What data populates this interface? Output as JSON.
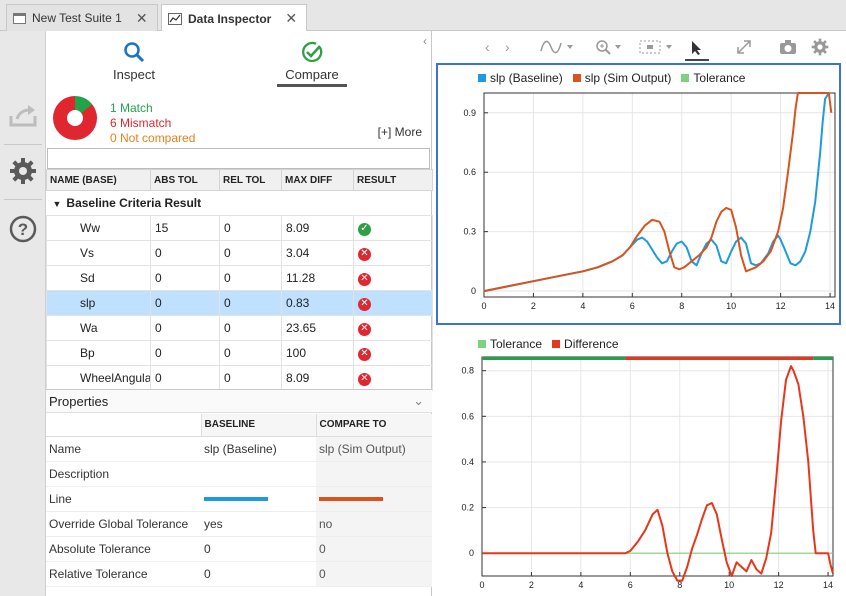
{
  "tabs": [
    {
      "label": "New Test Suite 1",
      "active": false
    },
    {
      "label": "Data Inspector",
      "active": true
    }
  ],
  "modes": {
    "inspect": "Inspect",
    "compare": "Compare"
  },
  "summary": {
    "match": "1 Match",
    "mismatch": "6 Mismatch",
    "not_compared": "0 Not compared",
    "more": "[+] More",
    "counts": {
      "match": 1,
      "mismatch": 6,
      "not_compared": 0
    }
  },
  "filter": {
    "placeholder": ""
  },
  "table": {
    "columns": [
      "NAME (BASE)",
      "ABS TOL",
      "REL TOL",
      "MAX DIFF",
      "RESULT"
    ],
    "group": "Baseline Criteria Result",
    "rows": [
      {
        "name": "Ww",
        "abs_tol": "15",
        "rel_tol": "0",
        "max_diff": "8.09",
        "result": "pass"
      },
      {
        "name": "Vs",
        "abs_tol": "0",
        "rel_tol": "0",
        "max_diff": "3.04",
        "result": "fail"
      },
      {
        "name": "Sd",
        "abs_tol": "0",
        "rel_tol": "0",
        "max_diff": "11.28",
        "result": "fail"
      },
      {
        "name": "slp",
        "abs_tol": "0",
        "rel_tol": "0",
        "max_diff": "0.83",
        "result": "fail"
      },
      {
        "name": "Wa",
        "abs_tol": "0",
        "rel_tol": "0",
        "max_diff": "23.65",
        "result": "fail"
      },
      {
        "name": "Bp",
        "abs_tol": "0",
        "rel_tol": "0",
        "max_diff": "100",
        "result": "fail"
      },
      {
        "name": "WheelAngularSpeed",
        "abs_tol": "0",
        "rel_tol": "0",
        "max_diff": "8.09",
        "result": "fail"
      }
    ]
  },
  "properties": {
    "title": "Properties",
    "col_baseline": "BASELINE",
    "col_compare": "COMPARE TO",
    "rows": [
      {
        "label": "Name",
        "baseline": "slp (Baseline)",
        "compare": "slp (Sim Output)"
      },
      {
        "label": "Description",
        "baseline": "",
        "compare": ""
      },
      {
        "label": "Line",
        "baseline": "",
        "compare": ""
      },
      {
        "label": "Override Global Tolerance",
        "baseline": "yes",
        "compare": "no"
      },
      {
        "label": "Absolute Tolerance",
        "baseline": "0",
        "compare": "0"
      },
      {
        "label": "Relative Tolerance",
        "baseline": "0",
        "compare": "0"
      }
    ]
  },
  "colors": {
    "baseline": "#1e9bdc",
    "sim": "#d9531e",
    "tolerance": "#7fd17f",
    "difference": "#e8361b",
    "match": "#22a34a",
    "mismatch": "#e0262e",
    "not_compared": "#e8801a",
    "selection": "#3b72d9"
  },
  "chart_data": [
    {
      "type": "line",
      "legend": [
        "slp (Baseline)",
        "slp (Sim Output)",
        "Tolerance"
      ],
      "xlim": [
        0,
        14.2
      ],
      "ylim": [
        -0.03,
        1.0
      ],
      "xticks": [
        0,
        2,
        4,
        6,
        8,
        10,
        12,
        14
      ],
      "yticks": [
        0,
        0.3,
        0.6,
        0.9
      ],
      "series": [
        {
          "name": "slp (Baseline)",
          "color": "#1e9bdc",
          "x": [
            0,
            1,
            2,
            3,
            4,
            4.6,
            5.2,
            5.6,
            5.9,
            6.2,
            6.4,
            6.6,
            6.8,
            7.0,
            7.2,
            7.4,
            7.6,
            7.8,
            8.0,
            8.2,
            8.4,
            8.6,
            8.8,
            9.0,
            9.2,
            9.4,
            9.6,
            9.8,
            10.0,
            10.2,
            10.4,
            10.6,
            10.8,
            11.0,
            11.2,
            11.5,
            11.7,
            11.9,
            12.0,
            12.2,
            12.4,
            12.6,
            12.8,
            13.0,
            13.2,
            13.4,
            13.6,
            13.7,
            13.8,
            13.95
          ],
          "y": [
            0,
            0.025,
            0.05,
            0.075,
            0.1,
            0.12,
            0.15,
            0.18,
            0.22,
            0.26,
            0.27,
            0.25,
            0.21,
            0.17,
            0.14,
            0.15,
            0.2,
            0.24,
            0.25,
            0.22,
            0.15,
            0.13,
            0.19,
            0.24,
            0.26,
            0.23,
            0.15,
            0.14,
            0.2,
            0.25,
            0.27,
            0.24,
            0.14,
            0.13,
            0.14,
            0.19,
            0.25,
            0.28,
            0.26,
            0.2,
            0.14,
            0.13,
            0.15,
            0.2,
            0.3,
            0.45,
            0.7,
            0.85,
            0.97,
            1.0
          ]
        },
        {
          "name": "slp (Sim Output)",
          "color": "#d9531e",
          "x": [
            0,
            1,
            2,
            3,
            4,
            4.6,
            5.2,
            5.6,
            5.9,
            6.2,
            6.5,
            6.8,
            7.1,
            7.3,
            7.5,
            7.7,
            7.9,
            8.1,
            8.4,
            8.7,
            9.0,
            9.2,
            9.4,
            9.6,
            9.8,
            10.0,
            10.2,
            10.4,
            10.6,
            10.8,
            11.0,
            11.3,
            11.6,
            11.9,
            12.1,
            12.3,
            12.5,
            12.6,
            12.7,
            12.8,
            13.0,
            13.2,
            13.4,
            13.6,
            13.8,
            13.95,
            14.05
          ],
          "y": [
            0,
            0.025,
            0.05,
            0.075,
            0.1,
            0.12,
            0.15,
            0.18,
            0.22,
            0.28,
            0.33,
            0.36,
            0.35,
            0.3,
            0.2,
            0.12,
            0.11,
            0.12,
            0.15,
            0.18,
            0.22,
            0.27,
            0.35,
            0.4,
            0.42,
            0.41,
            0.32,
            0.18,
            0.1,
            0.11,
            0.12,
            0.15,
            0.2,
            0.3,
            0.42,
            0.6,
            0.8,
            0.92,
            1.0,
            1.0,
            1.0,
            1.0,
            1.0,
            1.0,
            1.0,
            1.0,
            0.9
          ]
        },
        {
          "name": "Tolerance",
          "color": "#7fd17f",
          "x": [],
          "y": []
        }
      ]
    },
    {
      "type": "line",
      "legend": [
        "Tolerance",
        "Difference"
      ],
      "xlim": [
        0,
        14.2
      ],
      "ylim": [
        -0.1,
        0.86
      ],
      "xticks": [
        0,
        2,
        4,
        6,
        8,
        10,
        12,
        14
      ],
      "yticks": [
        0,
        0.2,
        0.4,
        0.6,
        0.8
      ],
      "series": [
        {
          "name": "Tolerance",
          "color": "#7fd17f",
          "x": [
            0,
            14.2
          ],
          "y": [
            0,
            0
          ]
        },
        {
          "name": "Difference",
          "color": "#e8361b",
          "x": [
            0,
            5.8,
            6.0,
            6.3,
            6.6,
            6.9,
            7.1,
            7.3,
            7.5,
            7.7,
            7.9,
            8.1,
            8.3,
            8.5,
            8.7,
            8.9,
            9.1,
            9.3,
            9.5,
            9.7,
            9.9,
            10.1,
            10.3,
            10.5,
            10.7,
            10.9,
            11.1,
            11.3,
            11.5,
            11.7,
            11.9,
            12.1,
            12.3,
            12.5,
            12.6,
            12.8,
            13.0,
            13.2,
            13.4,
            13.5,
            13.6,
            13.8,
            14.0,
            14.1,
            14.2
          ],
          "y": [
            0,
            0,
            0.01,
            0.05,
            0.1,
            0.17,
            0.19,
            0.12,
            0.0,
            -0.08,
            -0.12,
            -0.12,
            -0.06,
            0.02,
            0.08,
            0.15,
            0.21,
            0.22,
            0.17,
            0.06,
            -0.04,
            -0.1,
            -0.04,
            -0.06,
            -0.08,
            -0.03,
            -0.07,
            -0.09,
            -0.02,
            0.09,
            0.32,
            0.58,
            0.76,
            0.82,
            0.8,
            0.74,
            0.6,
            0.4,
            0.1,
            0.0,
            0.0,
            0.0,
            0.0,
            -0.05,
            -0.09
          ]
        }
      ],
      "status_bar": {
        "pass_until": 5.8,
        "fail_from": 5.8,
        "fail_until": 13.4
      }
    }
  ]
}
